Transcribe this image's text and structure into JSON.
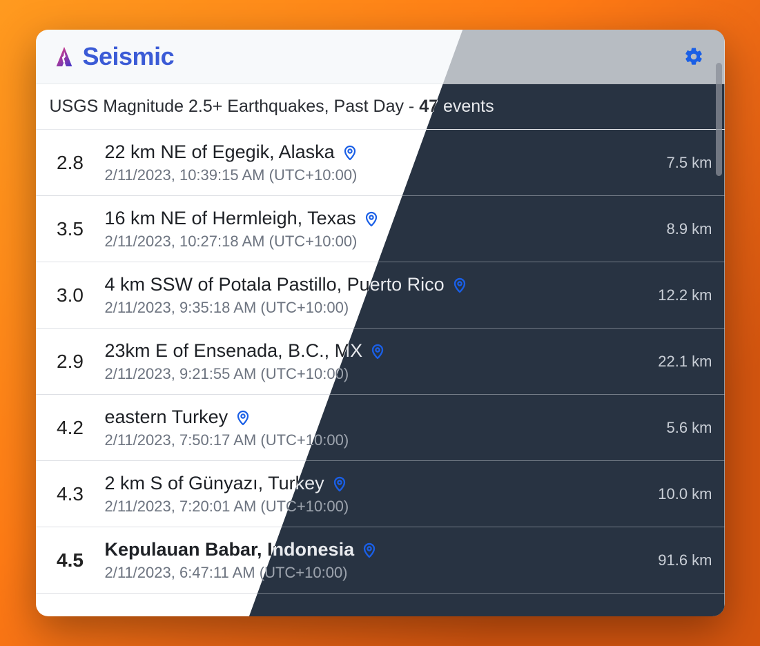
{
  "app": {
    "title": "Seismic"
  },
  "feed": {
    "description_prefix": "USGS Magnitude 2.5+ Earthquakes, Past Day - ",
    "count": "47",
    "description_suffix": " events"
  },
  "events": [
    {
      "mag": "2.8",
      "bold": false,
      "location": "22 km NE of Egegik, Alaska",
      "time": "2/11/2023, 10:39:15 AM (UTC+10:00)",
      "depth": "7.5 km"
    },
    {
      "mag": "3.5",
      "bold": false,
      "location": "16 km NE of Hermleigh, Texas",
      "time": "2/11/2023, 10:27:18 AM (UTC+10:00)",
      "depth": "8.9 km"
    },
    {
      "mag": "3.0",
      "bold": false,
      "location": "4 km SSW of Potala Pastillo, Puerto Rico",
      "time": "2/11/2023, 9:35:18 AM (UTC+10:00)",
      "depth": "12.2 km"
    },
    {
      "mag": "2.9",
      "bold": false,
      "location": "23km E of Ensenada, B.C., MX",
      "time": "2/11/2023, 9:21:55 AM (UTC+10:00)",
      "depth": "22.1 km"
    },
    {
      "mag": "4.2",
      "bold": false,
      "location": "eastern Turkey",
      "time": "2/11/2023, 7:50:17 AM (UTC+10:00)",
      "depth": "5.6 km"
    },
    {
      "mag": "4.3",
      "bold": false,
      "location": "2 km S of Günyazı, Turkey",
      "time": "2/11/2023, 7:20:01 AM (UTC+10:00)",
      "depth": "10.0 km"
    },
    {
      "mag": "4.5",
      "bold": true,
      "location": "Kepulauan Babar, Indonesia",
      "time": "2/11/2023, 6:47:11 AM (UTC+10:00)",
      "depth": "91.6 km"
    }
  ]
}
